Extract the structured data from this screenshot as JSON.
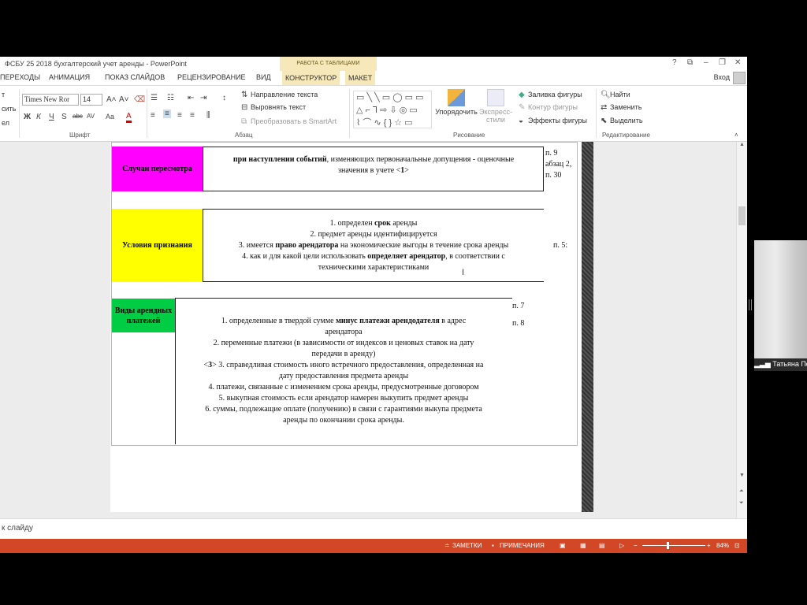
{
  "window": {
    "title": "ФСБУ 25 2018 бухгалтерский учет аренды - PowerPoint",
    "context_tab_group": "РАБОТА С ТАБЛИЦАМИ",
    "controls": [
      "?",
      "⧉",
      "–",
      "❐",
      "✕"
    ]
  },
  "tabs": [
    {
      "label": "ПЕРЕХОДЫ"
    },
    {
      "label": "АНИМАЦИЯ"
    },
    {
      "label": "ПОКАЗ СЛАЙДОВ"
    },
    {
      "label": "РЕЦЕНЗИРОВАНИЕ"
    },
    {
      "label": "ВИД"
    },
    {
      "label": "КОНСТРУКТОР"
    },
    {
      "label": "МАКЕТ"
    }
  ],
  "login": "Вход",
  "ribbon": {
    "clipboard_frag": [
      "т",
      "сить",
      "ел"
    ],
    "font_name": "Times New Ror",
    "font_size": "14",
    "font_group": "Шрифт",
    "paragraph_group": "Абзац",
    "text_direction": "Направление текста",
    "align_text": "Выровнять текст",
    "smartart": "Преобразовать в SmartArt",
    "drawing_group": "Рисование",
    "arrange": "Упорядочить",
    "express_styles": "Экспресс-стили",
    "shape_fill": "Заливка фигуры",
    "shape_outline": "Контур фигуры",
    "shape_effects": "Эффекты фигуры",
    "find": "Найти",
    "replace": "Заменить",
    "select": "Выделить",
    "editing_group": "Редактирование",
    "font_buttons": [
      "Ж",
      "К",
      "Ч",
      "S",
      "abc",
      "AV",
      "Aa",
      "A"
    ]
  },
  "slide": {
    "row1": {
      "label": "Случаи пересмотра",
      "label_color": "#ff00ff",
      "text_lines": [
        "при наступлении событий, изменяющих первоначальные допущения - оценочные",
        "значения в учете <1>"
      ],
      "ref_lines": [
        "п. 9",
        "абзац 2,",
        "п. 30"
      ]
    },
    "row2": {
      "label": "Условия признания",
      "label_color": "#ffff00",
      "text_lines": [
        "1. определен срок аренды",
        "2. предмет аренды идентифицируется",
        "3. имеется право арендатора на экономические выгоды в течение срока аренды",
        "4. как и для какой цели использовать определяет арендатор, в соответствии с",
        "техническими характеристиками"
      ],
      "ref": "п. 5:"
    },
    "row3": {
      "label": "Виды арендных платежей",
      "label_color": "#00cc44",
      "text_lines": [
        "1. определенные в твердой сумме минус платежи арендодателя в адрес",
        "арендатора",
        "2. переменные платежи (в зависимости от индексов и ценовых ставок на дату",
        "передачи в аренду)",
        "<3> 3. справедливая стоимость иного встречного предоставления, определенная на",
        "дату предоставления предмета аренды",
        "4. платежи, связанные с изменением срока аренды, предусмотренные договором",
        "5. выкупная стоимость если арендатор намерен выкупить предмет аренды",
        "6. суммы, подлежащие оплате (получению) в связи с гарантиями выкупа предмета",
        "аренды по окончании срока аренды."
      ],
      "ref_lines": [
        "п. 7",
        "п. 8"
      ]
    }
  },
  "notes_placeholder": "к слайду",
  "status": {
    "notes": "ЗАМЕТКИ",
    "comments": "ПРИМЕЧАНИЯ",
    "zoom": "84%"
  },
  "webcam": {
    "name": "Татьяна По"
  }
}
